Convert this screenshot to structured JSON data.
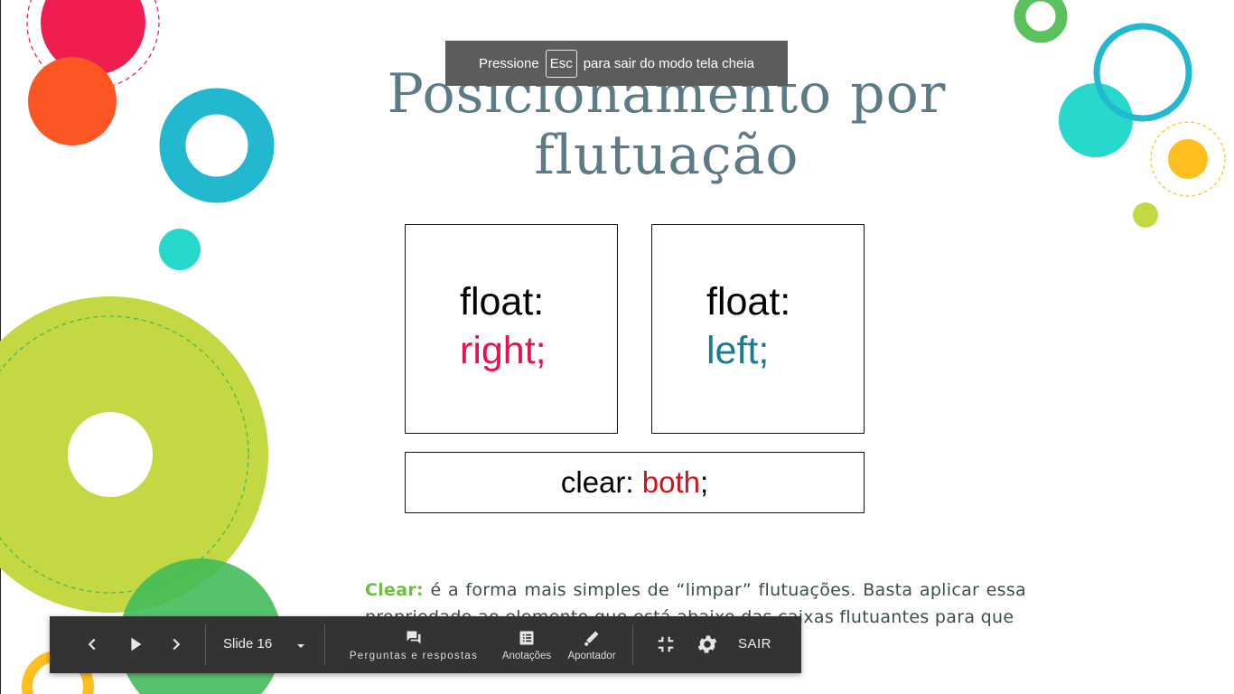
{
  "fullscreen_notice": {
    "before": "Pressione",
    "key": "Esc",
    "after": "para sair do modo tela cheia"
  },
  "slide": {
    "title_line1": "Posicionamento por",
    "title_line2": "flutuação",
    "box_right": {
      "prop": "float:",
      "value": "right;"
    },
    "box_left": {
      "prop": "float:",
      "value": "left;"
    },
    "box_clear": {
      "prop": "clear:",
      "value": "both",
      "end": ";"
    },
    "paragraph": {
      "term": "Clear:",
      "text": " é a forma mais simples de “limpar” flutuações. Basta aplicar essa propriedade ao elemento que está abaixo das caixas flutuantes para que"
    }
  },
  "toolbar": {
    "slide_selector": "Slide 16",
    "qa_label": "Perguntas e respostas",
    "notes_label": "Anotações",
    "pointer_label": "Apontador",
    "exit_label": "SAIR"
  },
  "colors": {
    "title": "#5d7b86",
    "right_value": "#e8124e",
    "left_value": "#167c8e",
    "both_value": "#d3121b",
    "clear_term": "#6cbf3f",
    "toolbar_bg": "#333333"
  }
}
